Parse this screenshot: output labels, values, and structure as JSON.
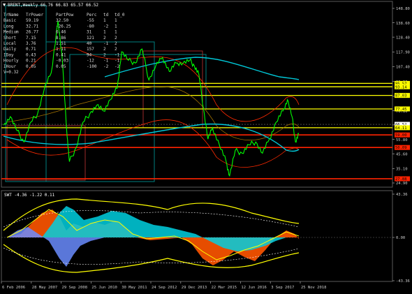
{
  "symbol_header": "BRENT,Weekly  66.76 66.83 65.57 66.52",
  "indicator_header": "SWT -4.36 -1.22 0.11",
  "table": {
    "columns": [
      "TrName",
      "TrPower",
      "PartPow",
      "Perc",
      "td",
      "td_0"
    ],
    "rows": [
      [
        "Basic",
        "59.19",
        "32.50",
        "-55",
        "1",
        "1"
      ],
      [
        "Long",
        "32.71",
        "-26.25",
        "-80",
        "-2",
        "1"
      ],
      [
        "Medium",
        "26.77",
        "6.46",
        "31",
        "1",
        "1"
      ],
      [
        "Short",
        "7.15",
        "8.86",
        "121",
        "2",
        "2"
      ],
      [
        "Local",
        "3.76",
        "1.51",
        "40",
        "-1",
        "2"
      ],
      [
        "Daily",
        "0.71",
        "1.11",
        "157",
        "2",
        "2"
      ],
      [
        "IDay",
        "0.43",
        "0.41",
        "94",
        "2",
        "-1"
      ],
      [
        "Hourly",
        "0.21",
        "-0.03",
        "-12",
        "-1",
        "-1"
      ],
      [
        "IHour",
        "0.05",
        "0.05",
        "-100",
        "-2",
        "-2"
      ]
    ],
    "footer": "V=0.32"
  },
  "main_axis": {
    "ticks": [
      "148.80",
      "138.60",
      "128.40",
      "117.90",
      "107.40",
      "96.90",
      "86.40",
      "76.10",
      "66.10",
      "55.80",
      "45.60",
      "35.10",
      "24.90"
    ],
    "level_labels": [
      {
        "text": "95.57",
        "color": "#ffff00"
      },
      {
        "text": "93.14",
        "color": "#ffff00"
      },
      {
        "text": "87.03",
        "color": "#ffff00"
      },
      {
        "text": "77.45",
        "color": "#ffff00"
      },
      {
        "text": "66.52",
        "color": "#ffffff"
      },
      {
        "text": "64.11",
        "color": "#ffff00"
      },
      {
        "text": "59.00",
        "color": "#ff2200"
      },
      {
        "text": "50.09",
        "color": "#ff2200"
      },
      {
        "text": "27.88",
        "color": "#ff2200"
      }
    ]
  },
  "sub_axis": {
    "ticks": [
      "43.36",
      "0.00",
      "-43.36"
    ]
  },
  "x_axis": {
    "ticks": [
      "6 Feb 2006",
      "28 May 2007",
      "29 Sep 2008",
      "25 Jun 2010",
      "30 May 2011",
      "24 Sep 2012",
      "29 Dec 2013",
      "22 Mar 2015",
      "12 Jun 2016",
      "3 Sep 2017",
      "25 Nov 2018"
    ]
  },
  "colors": {
    "background": "#000000",
    "price": "#00ff00",
    "ma_cyan": "#00c8d8",
    "envelope": "#ff2a00",
    "yellow": "#ffff00",
    "red_level": "#ff2200",
    "teal_box": "#008080",
    "osc_orange": "#ff5500",
    "osc_cyan": "#00d0e0",
    "osc_blue": "#6a8cff"
  },
  "chart_data": {
    "type": "line",
    "x": [
      2006.1,
      2006.4,
      2006.7,
      2007.0,
      2007.3,
      2007.6,
      2007.9,
      2008.2,
      2008.5,
      2008.7,
      2008.9,
      2009.0,
      2009.3,
      2009.6,
      2009.9,
      2010.2,
      2010.5,
      2010.8,
      2011.1,
      2011.3,
      2011.6,
      2011.9,
      2012.2,
      2012.5,
      2012.8,
      2013.1,
      2013.4,
      2013.7,
      2014.0,
      2014.3,
      2014.5,
      2014.7,
      2014.9,
      2015.1,
      2015.3,
      2015.6,
      2015.9,
      2016.05,
      2016.3,
      2016.6,
      2016.9,
      2017.2,
      2017.5,
      2017.8,
      2018.1,
      2018.4,
      2018.6,
      2018.8,
      2018.95,
      2019.1
    ],
    "series": [
      {
        "values": [
          66,
          72,
          62,
          54,
          68,
          74,
          92,
          103,
          140,
          110,
          58,
          40,
          50,
          68,
          74,
          80,
          76,
          84,
          92,
          118,
          112,
          110,
          120,
          98,
          108,
          114,
          104,
          110,
          110,
          112,
          108,
          102,
          78,
          56,
          64,
          52,
          40,
          30,
          48,
          46,
          52,
          54,
          46,
          56,
          68,
          76,
          84,
          72,
          54,
          60
        ]
      }
    ],
    "ylim": [
      24.9,
      148.8
    ],
    "price_levels": {
      "yellow": [
        95.57,
        93.14,
        87.03,
        77.45,
        64.11
      ],
      "red": [
        59.0,
        50.09,
        27.88
      ],
      "last": 66.52
    },
    "oscillator_ylim": [
      -43.36,
      43.36
    ]
  }
}
